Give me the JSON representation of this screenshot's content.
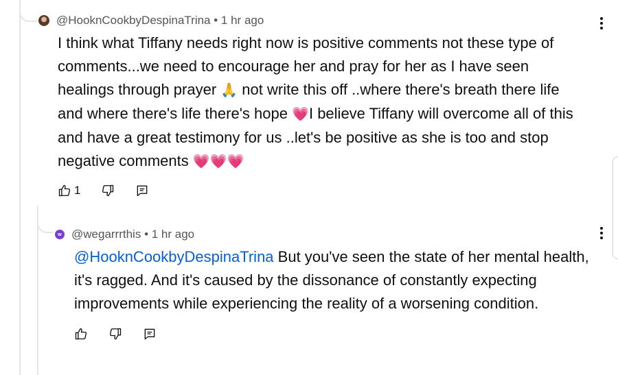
{
  "comments": [
    {
      "author": "@HooknCookbyDespinaTrina",
      "time": "1 hr ago",
      "separator": " • ",
      "text_parts": [
        "I think what Tiffany needs right now is positive comments not these type of comments...we need to encourage her and pray for her as I have seen healings through prayer ",
        "🙏",
        " not write this off ..where there's breath there life and where there's life there's hope ",
        "💗",
        "I believe Tiffany will overcome all of this and have a great testimony for us ..let's be positive as she is too and stop negative comments ",
        "💗💗💗"
      ],
      "like_count": "1"
    },
    {
      "author": "@wegarrrthis",
      "time": "1 hr ago",
      "separator": " • ",
      "avatar_letter": "w",
      "mention": "@HooknCookbyDespinaTrina",
      "text": "  But you've seen the state of her mental health, it's ragged. And it's caused by the dissonance of constantly expecting improvements while experiencing the reality of a worsening condition.",
      "like_count": ""
    }
  ],
  "icons": {
    "like": "thumbs-up-icon",
    "dislike": "thumbs-down-icon",
    "reply": "reply-icon",
    "menu": "more-vertical-icon"
  },
  "colors": {
    "mention": "#065fd4",
    "meta": "#555555",
    "heart": "#e8336d",
    "avatar2": "#7b3fd0"
  }
}
